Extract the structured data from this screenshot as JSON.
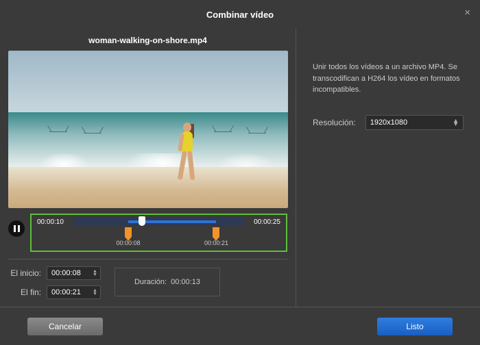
{
  "modal": {
    "title": "Combinar vídeo",
    "close_label": "×"
  },
  "file": {
    "name": "woman-walking-on-shore.mp4"
  },
  "playback": {
    "state": "paused",
    "current_time": "00:00:10",
    "total_time": "00:00:25",
    "progress_pct_start": 32,
    "progress_pct_end": 84,
    "playhead_pct": 40
  },
  "trim": {
    "start_marker_pct": 32,
    "start_marker_label": "00:00:08",
    "end_marker_pct": 84,
    "end_marker_label": "00:00:21"
  },
  "fields": {
    "start_label": "El inicio:",
    "start_value": "00:00:08",
    "end_label": "El fin:",
    "end_value": "00:00:21",
    "duration_label": "Duración:",
    "duration_value": "00:00:13"
  },
  "right_panel": {
    "description": "Unir todos los vídeos a un archivo MP4. Se transcodifican a H264 los vídeo en formatos incompatibles.",
    "resolution_label": "Resolución:",
    "resolution_value": "1920x1080"
  },
  "footer": {
    "cancel": "Cancelar",
    "done": "Listo"
  }
}
